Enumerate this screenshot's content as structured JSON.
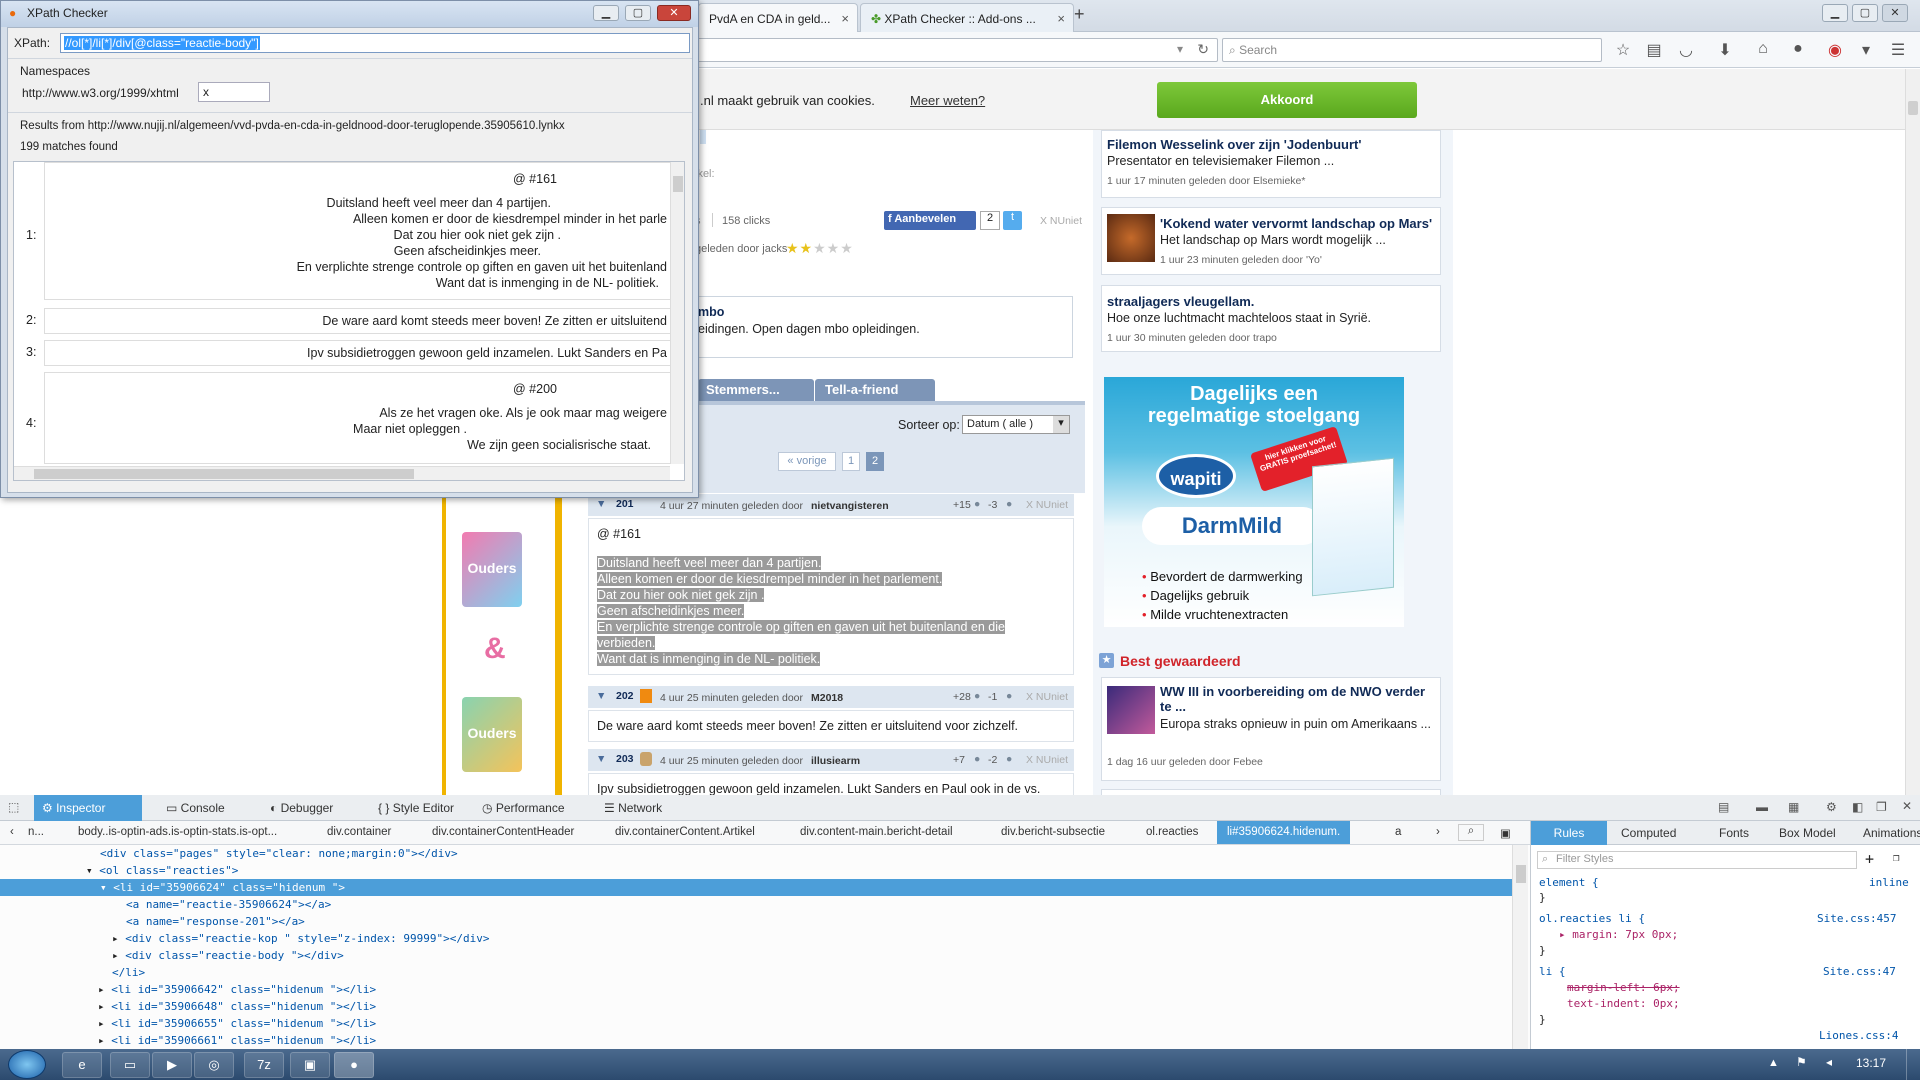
{
  "browser": {
    "tabs": [
      {
        "label": "PvdA en CDA in geld..."
      },
      {
        "label": "XPath Checker :: Add-ons ..."
      }
    ],
    "new_tab": "+",
    "search_placeholder": "Search"
  },
  "cookie": {
    "text": ".nl maakt gebruik van cookies.",
    "link": "Meer weten?",
    "button": "Akkoord"
  },
  "article": {
    "label_suffix": "ikel:",
    "stats_s": "s",
    "clicks": "158 clicks",
    "recommend": "Aanbevelen",
    "recommend_count": "2",
    "report": "X NUniet",
    "posted_by_suffix": "geleden door jacks",
    "promo_title": "mbo",
    "promo_text": "eidingen. Open dagen mbo opleidingen.",
    "tab_voters": "Stemmers...",
    "tab_tellafriend": "Tell-a-friend",
    "sort_label": "Sorteer op:",
    "sort_value": "Datum ( alle )",
    "prev": "« vorige",
    "page1": "1",
    "page2": "2"
  },
  "comments": [
    {
      "num": "201",
      "meta": "4 uur 27 minuten geleden door",
      "user": "nietvangisteren",
      "plus": "+15",
      "minus": "-3",
      "report": "X NUniet",
      "ref": "@ #161",
      "lines": [
        "Duitsland heeft veel meer dan 4 partijen.",
        "Alleen komen er door de kiesdrempel minder in het parlement.",
        "Dat zou hier ook niet gek zijn .",
        "Geen afscheidinkjes meer.",
        "En verplichte strenge controle op giften en gaven uit het buitenland en die",
        "verbieden.",
        "Want dat is inmenging in de NL- politiek."
      ]
    },
    {
      "num": "202",
      "meta": "4 uur 25 minuten geleden door",
      "user": "M2018",
      "plus": "+28",
      "minus": "-1",
      "report": "X NUniet",
      "text": "De ware aard komt steeds meer boven! Ze zitten er uitsluitend voor zichzelf."
    },
    {
      "num": "203",
      "meta": "4 uur 25 minuten geleden door",
      "user": "illusiearm",
      "plus": "+7",
      "minus": "-2",
      "report": "X NUniet",
      "text": "Ipv subsidietroggen gewoon geld inzamelen. Lukt Sanders en Paul ook in de vs."
    }
  ],
  "sidebar": {
    "items": [
      {
        "title": "Filemon Wesselink over zijn 'Jodenbuurt'",
        "desc": "Presentator en televisiemaker Filemon ...",
        "meta": "1 uur 17 minuten geleden door Elsemieke*"
      },
      {
        "title": "'Kokend water vervormt landschap op Mars'",
        "desc": "Het landschap op Mars wordt mogelijk ...",
        "meta": "1 uur 23 minuten geleden door 'Yo'"
      },
      {
        "title": "straaljagers vleugellam.",
        "desc": "Hoe onze luchtmacht machteloos staat in Syrië.",
        "meta": "1 uur 30 minuten geleden door trapo"
      }
    ],
    "best_heading": "Best gewaardeerd",
    "best": {
      "title": "WW III in voorbereiding om de NWO verder te ...",
      "desc": "Europa straks opnieuw in puin om Amerikaans ...",
      "meta": "1 dag 16 uur geleden door Febee"
    }
  },
  "ad": {
    "headline1": "Dagelijks een",
    "headline2": "regelmatige stoelgang",
    "brand": "wapiti",
    "product": "DarmMild",
    "badge": "hier klikken voor GRATIS proefsachet!",
    "bullets": [
      "Bevordert de darmwerking",
      "Dagelijks gebruik",
      "Milde vruchtenextracten"
    ],
    "side_ad_logo": "Ouders",
    "amp": "&"
  },
  "xpath": {
    "title": "XPath Checker",
    "label": "XPath:",
    "expression": "//ol[*]/li[*]/div[@class=\"reactie-body\"]",
    "ns_heading": "Namespaces",
    "ns_uri": "http://www.w3.org/1999/xhtml",
    "ns_prefix": "x",
    "results_from": "Results from http://www.nujij.nl/algemeen/vvd-pvda-en-cda-in-geldnood-door-teruglopende.35905610.lynkx",
    "matches": "199 matches found",
    "results": [
      {
        "n": "1:",
        "lines": [
          "@ #161",
          "Duitsland heeft veel meer dan 4 partijen.",
          "Alleen komen er door de kiesdrempel minder in het parle",
          "Dat zou hier ook niet gek zijn .",
          "Geen afscheidinkjes meer.",
          "En verplichte strenge controle op giften en gaven uit het buitenland",
          "Want dat is inmenging in de NL- politiek."
        ]
      },
      {
        "n": "2:",
        "lines": [
          "De ware aard komt steeds meer boven! Ze zitten er uitsluitend"
        ]
      },
      {
        "n": "3:",
        "lines": [
          "Ipv subsidietroggen gewoon geld inzamelen. Lukt Sanders en Pa"
        ]
      },
      {
        "n": "4:",
        "lines": [
          "@ #200",
          "Als ze het vragen oke. Als je ook maar mag weigere",
          "Maar niet opleggen .",
          "We zijn geen socialisrische staat."
        ]
      }
    ]
  },
  "devtools": {
    "tabs": [
      "Inspector",
      "Console",
      "Debugger",
      "Style Editor",
      "Performance",
      "Network"
    ],
    "breadcrumbs": [
      "n...",
      "body..is-optin-ads.is-optin-stats.is-opt...",
      "div.container",
      "div.containerContentHeader",
      "div.containerContent.Artikel",
      "div.content-main.bericht-detail",
      "div.bericht-subsectie",
      "ol.reacties",
      "li#35906624.hidenum.",
      "a"
    ],
    "markup": [
      "<div class=\"pages\" style=\"clear: none;margin:0\"></div>",
      "<ol class=\"reacties\">",
      "<li id=\"35906624\" class=\"hidenum \">",
      "<a name=\"reactie-35906624\"></a>",
      "<a name=\"response-201\"></a>",
      "<div class=\"reactie-kop \" style=\"z-index: 99999\"></div>",
      "<div class=\"reactie-body \"></div>",
      "</li>",
      "<li id=\"35906642\" class=\"hidenum \"></li>",
      "<li id=\"35906648\" class=\"hidenum \"></li>",
      "<li id=\"35906655\" class=\"hidenum \"></li>",
      "<li id=\"35906661\" class=\"hidenum \"></li>"
    ],
    "rules_tabs": [
      "Rules",
      "Computed",
      "Fonts",
      "Box Model",
      "Animations"
    ],
    "filter_placeholder": "Filter Styles",
    "rules": [
      "element {",
      "}",
      "ol.reacties li {",
      "margin: 7px 0px;",
      "}",
      "li {",
      "margin-left: 6px;",
      "text-indent: 0px;",
      "}"
    ],
    "rule_sources": [
      "inline",
      "Site.css:457",
      "Site.css:47",
      "Liones.css:4"
    ]
  },
  "taskbar": {
    "time": "13:17"
  }
}
